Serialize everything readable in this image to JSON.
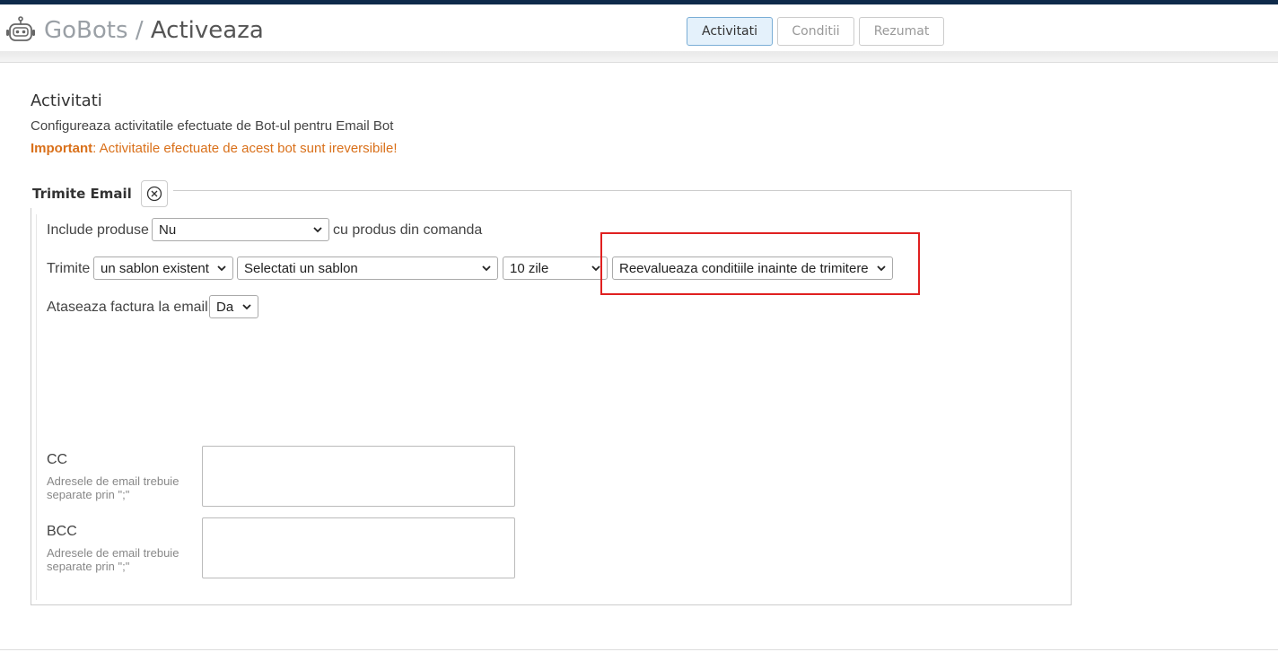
{
  "header": {
    "brand": "GoBots",
    "separator": "/",
    "current": "Activeaza",
    "logo_icon": "robot-icon",
    "tabs": [
      {
        "label": "Activitati",
        "active": true
      },
      {
        "label": "Conditii",
        "active": false
      },
      {
        "label": "Rezumat",
        "active": false
      }
    ]
  },
  "section": {
    "title": "Activitati",
    "description": "Configureaza activitatile efectuate de Bot-ul pentru Email Bot",
    "warning_bold": "Important",
    "warning_text": ": Activitatile efectuate de acest bot sunt ireversibile!"
  },
  "activity": {
    "title": "Trimite Email",
    "close_icon": "close-circle-icon",
    "include_label": "Include produse",
    "include_value": "Nu",
    "include_suffix": "cu produs din comanda",
    "send_label": "Trimite",
    "template_source_value": "un sablon existent",
    "template_value": "Selectati un sablon",
    "delay_value": "10 zile",
    "reevaluate_value": "Reevalueaza conditiile inainte de trimitere",
    "attach_label": "Ataseaza factura la email",
    "attach_value": "Da",
    "cc_label": "CC",
    "cc_help": "Adresele de email trebuie separate prin \";\"",
    "bcc_label": "BCC",
    "bcc_help": "Adresele de email trebuie separate prin \";\""
  },
  "colors": {
    "topbar": "#0e2a4a",
    "warning": "#d9701a",
    "active_tab_bg": "#e4f1fb",
    "highlight": "#e02020"
  }
}
